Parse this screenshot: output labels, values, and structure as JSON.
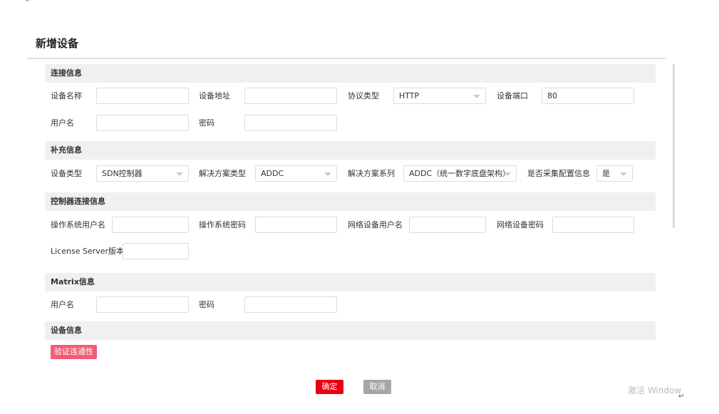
{
  "title": "新增设备",
  "sections": {
    "conn": "连接信息",
    "extra": "补充信息",
    "ctrl": "控制器连接信息",
    "matrix": "Matrix信息",
    "device": "设备信息"
  },
  "conn": {
    "name_label": "设备名称",
    "name": "",
    "addr_label": "设备地址",
    "addr": "",
    "proto_label": "协议类型",
    "proto": "HTTP",
    "port_label": "设备端口",
    "port": "80",
    "user_label": "用户名",
    "user": "",
    "pwd_label": "密码",
    "pwd": ""
  },
  "extra": {
    "type_label": "设备类型",
    "type": "SDN控制器",
    "sol_type_label": "解决方案类型",
    "sol_type": "ADDC",
    "sol_series_label": "解决方案系列",
    "sol_series": "ADDC（统一数字底盘架构）",
    "collect_label": "是否采集配置信息",
    "collect": "是"
  },
  "ctrl": {
    "os_user_label": "操作系统用户名",
    "os_pwd_label": "操作系统密码",
    "net_user_label": "网络设备用户名",
    "net_pwd_label": "网络设备密码",
    "license_label": "License Server版本"
  },
  "matrix": {
    "user_label": "用户名",
    "pwd_label": "密码"
  },
  "buttons": {
    "verify": "验证连通性",
    "ok": "确定",
    "cancel": "取消"
  },
  "watermark": "激活 Window",
  "colors": {
    "primary": "#e60012",
    "verify": "#f25c74",
    "cancel": "#a6a6a6"
  }
}
